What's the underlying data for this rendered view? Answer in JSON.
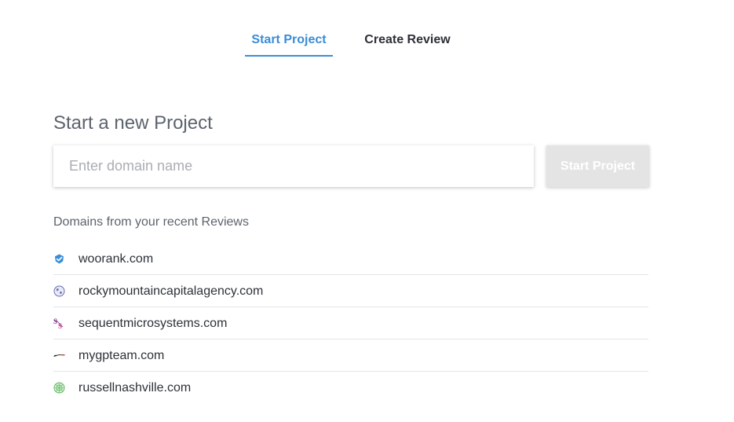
{
  "tabs": [
    {
      "label": "Start Project",
      "active": true
    },
    {
      "label": "Create Review",
      "active": false
    }
  ],
  "project": {
    "title": "Start a new Project",
    "input_value": "",
    "input_placeholder": "Enter domain name",
    "button_label": "Start Project"
  },
  "recent": {
    "label": "Domains from your recent Reviews",
    "domains": [
      {
        "domain": "woorank.com",
        "icon": "woorank-check-icon"
      },
      {
        "domain": "rockymountaincapitalagency.com",
        "icon": "globe-icon"
      },
      {
        "domain": "sequentmicrosystems.com",
        "icon": "sequent-logo-icon"
      },
      {
        "domain": "mygpteam.com",
        "icon": "mygpteam-logo-icon"
      },
      {
        "domain": "russellnashville.com",
        "icon": "russell-logo-icon"
      }
    ]
  },
  "colors": {
    "accent": "#3a8dd6",
    "text_dark": "#2d3138",
    "text_muted": "#5d636d",
    "placeholder": "#a9adb3",
    "button_disabled_bg": "#e4e4e4",
    "divider": "#e3e5e8"
  }
}
